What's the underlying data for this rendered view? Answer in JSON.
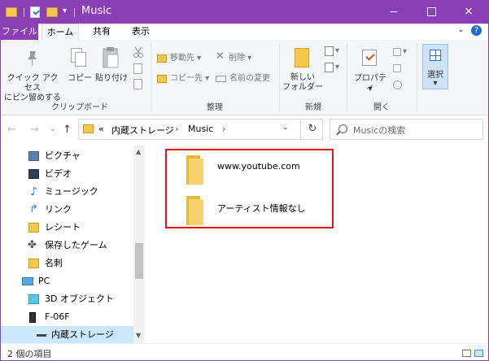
{
  "window": {
    "title": "Music",
    "accent": "#8a3fb5"
  },
  "quick_access": {
    "icons": [
      "folder-icon",
      "properties-check-icon",
      "new-folder-icon",
      "dropdown-icon"
    ]
  },
  "window_controls": {
    "minimize": "minimize-icon",
    "maximize": "maximize-icon",
    "close": "×"
  },
  "tabs": [
    {
      "label": "ファイル"
    },
    {
      "label": "ホーム"
    },
    {
      "label": "共有"
    },
    {
      "label": "表示"
    }
  ],
  "ribbon": {
    "clipboard": {
      "pin_label_1": "クイック アクセス",
      "pin_label_2": "にピン留めする",
      "copy": "コピー",
      "paste": "貼り付け",
      "label": "クリップボード"
    },
    "organize": {
      "move_to": "移動先",
      "delete": "削除",
      "copy_to": "コピー先",
      "rename": "名前の変更",
      "label": "整理"
    },
    "new": {
      "new_folder_1": "新しい",
      "new_folder_2": "フォルダー",
      "label": "新規"
    },
    "open": {
      "properties": "プロパティ",
      "label": "開く"
    },
    "select": {
      "label": "選択"
    }
  },
  "address": {
    "prefix": "«",
    "crumbs": [
      "内蔵ストレージ",
      "Music"
    ],
    "separator": "›",
    "dropdown": "⌄",
    "refresh": "↻"
  },
  "search": {
    "placeholder": "Musicの検索"
  },
  "sidebar": {
    "items": [
      {
        "label": "ピクチャ",
        "icon": "pictures-icon"
      },
      {
        "label": "ビデオ",
        "icon": "videos-icon"
      },
      {
        "label": "ミュージック",
        "icon": "music-icon"
      },
      {
        "label": "リンク",
        "icon": "links-icon"
      },
      {
        "label": "レシート",
        "icon": "folder-icon"
      },
      {
        "label": "保存したゲーム",
        "icon": "saved-games-icon"
      },
      {
        "label": "名刺",
        "icon": "folder-icon"
      },
      {
        "label": "PC",
        "icon": "pc-icon"
      },
      {
        "label": "3D オブジェクト",
        "icon": "3d-objects-icon"
      },
      {
        "label": "F-06F",
        "icon": "device-icon"
      },
      {
        "label": "内蔵ストレージ",
        "icon": "storage-icon"
      }
    ]
  },
  "files": [
    {
      "name": "www.youtube.com",
      "icon": "folder-icon"
    },
    {
      "name": "アーティスト情報なし",
      "icon": "folder-icon"
    }
  ],
  "highlight_color": "#e0141a",
  "status": {
    "text": "2 個の項目"
  }
}
